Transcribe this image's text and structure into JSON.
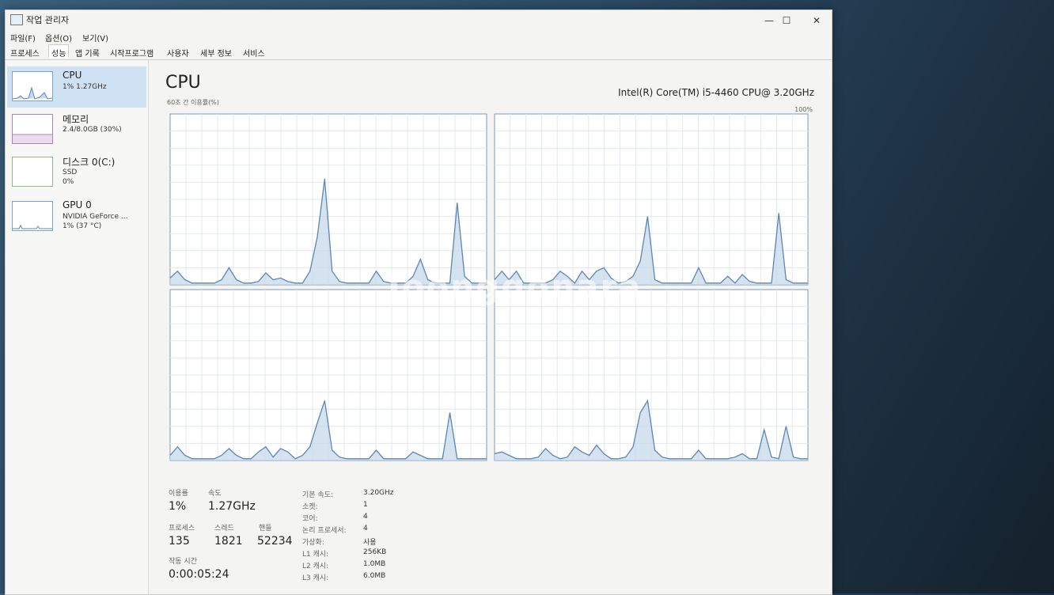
{
  "window": {
    "title": "작업 관리자",
    "controls": {
      "minimize": "—",
      "maximize": "☐",
      "close": "✕"
    }
  },
  "menu": [
    "파일(F)",
    "옵션(O)",
    "보기(V)"
  ],
  "tabs": [
    "프로세스",
    "성능",
    "앱 기록",
    "시작프로그램",
    "사용자",
    "세부 정보",
    "서비스"
  ],
  "active_tab": "성능",
  "sidebar": {
    "items": [
      {
        "title": "CPU",
        "sub1": "1% 1.27GHz",
        "sub2": ""
      },
      {
        "title": "메모리",
        "sub1": "2.4/8.0GB (30%)",
        "sub2": ""
      },
      {
        "title": "디스크 0(C:)",
        "sub1": "SSD",
        "sub2": "0%"
      },
      {
        "title": "GPU 0",
        "sub1": "NVIDIA GeForce ...",
        "sub2": "1% (37 °C)"
      }
    ]
  },
  "main": {
    "title": "CPU",
    "cpu_model": "Intel(R) Core(TM) i5-4460 CPU@ 3.20GHz",
    "graph_label": "60초 간 이용률(%)",
    "max_label": "100%",
    "accent": "#7ea4c9",
    "fill": "#c7d8ea"
  },
  "stats": {
    "utilization_label": "이용률",
    "utilization": "1%",
    "speed_label": "속도",
    "speed": "1.27GHz",
    "processes_label": "프로세스",
    "processes": "135",
    "threads_label": "스레드",
    "threads": "1821",
    "handles_label": "핸들",
    "handles": "52234",
    "uptime_label": "작동 시간",
    "uptime": "0:00:05:24"
  },
  "info": [
    {
      "label": "기본 속도:",
      "value": "3.20GHz"
    },
    {
      "label": "소켓:",
      "value": "1"
    },
    {
      "label": "코어:",
      "value": "4"
    },
    {
      "label": "논리 프로세서:",
      "value": "4"
    },
    {
      "label": "가상화:",
      "value": "사용"
    },
    {
      "label": "L1 캐시:",
      "value": "256KB"
    },
    {
      "label": "L2 캐시:",
      "value": "1.0MB"
    },
    {
      "label": "L3 캐시:",
      "value": "6.0MB"
    }
  ],
  "watermark": "Joonggonara",
  "chart_data": [
    {
      "type": "area",
      "name": "core-0",
      "ylim": [
        0,
        100
      ],
      "values": [
        4,
        8,
        3,
        1,
        1,
        1,
        1,
        3,
        10,
        3,
        1,
        1,
        2,
        7,
        3,
        4,
        2,
        1,
        1,
        8,
        28,
        62,
        8,
        2,
        1,
        1,
        1,
        1,
        8,
        2,
        1,
        1,
        1,
        5,
        15,
        3,
        1,
        1,
        1,
        48,
        5,
        1,
        1,
        1
      ]
    },
    {
      "type": "area",
      "name": "core-1",
      "ylim": [
        0,
        100
      ],
      "values": [
        3,
        8,
        3,
        8,
        1,
        1,
        1,
        1,
        3,
        8,
        5,
        1,
        8,
        3,
        8,
        10,
        4,
        1,
        2,
        5,
        14,
        40,
        3,
        1,
        1,
        1,
        1,
        1,
        10,
        1,
        1,
        1,
        5,
        1,
        6,
        2,
        1,
        1,
        1,
        42,
        3,
        1,
        1,
        1
      ]
    },
    {
      "type": "area",
      "name": "core-2",
      "ylim": [
        0,
        100
      ],
      "values": [
        3,
        8,
        3,
        1,
        1,
        1,
        1,
        3,
        7,
        3,
        1,
        1,
        5,
        8,
        2,
        7,
        5,
        1,
        3,
        8,
        22,
        35,
        6,
        2,
        1,
        1,
        1,
        1,
        6,
        1,
        1,
        1,
        1,
        5,
        3,
        1,
        1,
        1,
        28,
        1,
        1,
        1,
        1,
        1
      ]
    },
    {
      "type": "area",
      "name": "core-3",
      "ylim": [
        0,
        100
      ],
      "values": [
        4,
        5,
        3,
        1,
        1,
        1,
        2,
        7,
        3,
        1,
        2,
        8,
        5,
        3,
        9,
        4,
        1,
        1,
        2,
        8,
        28,
        35,
        6,
        2,
        1,
        1,
        1,
        1,
        6,
        1,
        1,
        1,
        1,
        2,
        4,
        1,
        1,
        18,
        2,
        1,
        20,
        2,
        1,
        1
      ]
    }
  ]
}
